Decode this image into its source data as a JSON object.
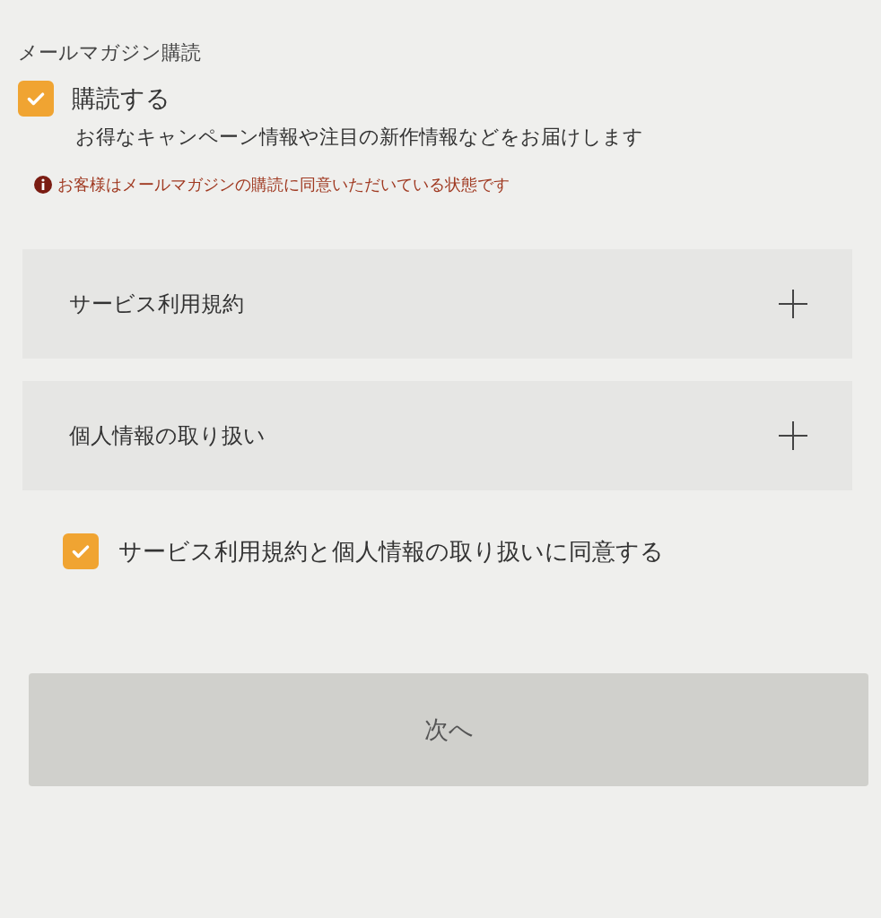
{
  "section_title": "メールマガジン購読",
  "newsletter": {
    "label": "購読する",
    "checked": true,
    "description": "お得なキャンペーン情報や注目の新作情報などをお届けします",
    "notice": "お客様はメールマガジンの購読に同意いただいている状態です"
  },
  "accordions": [
    {
      "label": "サービス利用規約",
      "expanded": false
    },
    {
      "label": "個人情報の取り扱い",
      "expanded": false
    }
  ],
  "agreement": {
    "label": "サービス利用規約と個人情報の取り扱いに同意する",
    "checked": true
  },
  "next_button": {
    "label": "次へ",
    "disabled": true
  }
}
